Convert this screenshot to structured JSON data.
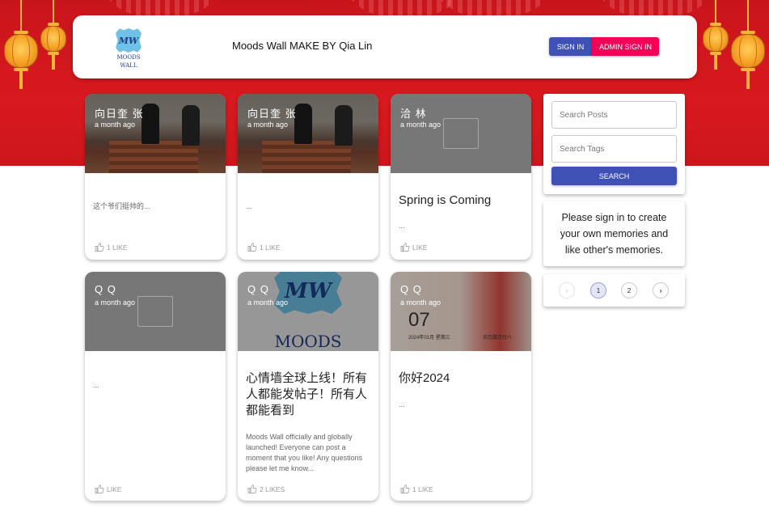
{
  "header": {
    "logo_initials": "MW",
    "logo_line1": "MOODS",
    "logo_line2": "WALL",
    "title": "Moods Wall MAKE BY Qia Lin",
    "signin_label": "SIGN IN",
    "admin_signin_label": "ADMIN SIGN IN"
  },
  "posts": [
    {
      "author": "向日奎 张",
      "time": "a month ago",
      "title": "",
      "message": "这个爷们挺帅的...",
      "likes": "1 LIKE",
      "image": "photo"
    },
    {
      "author": "向日奎 张",
      "time": "a month ago",
      "title": "",
      "message": "...",
      "likes": "1 LIKE",
      "image": "photo"
    },
    {
      "author": "洽 林",
      "time": "a month ago",
      "title": "Spring is Coming",
      "message": "...",
      "likes": "LIKE",
      "image": "placeholder"
    },
    {
      "author": "Q Q",
      "time": "a month ago",
      "title": "",
      "message": "...",
      "likes": "LIKE",
      "image": "placeholder"
    },
    {
      "author": "Q Q",
      "time": "a month ago",
      "title": "心情墙全球上线！所有人都能发帖子！所有人都能看到",
      "message": "Moods Wall officially and globally launched! Everyone can post a moment that you like! Any questions please let me know...",
      "likes": "2 LIKES",
      "image": "logo",
      "image_text_initials": "MW",
      "image_text_word": "MOODS"
    },
    {
      "author": "Q Q",
      "time": "a month ago",
      "title": "你好2024",
      "message": "...",
      "likes": "1 LIKE",
      "image": "calendar",
      "calendar_day": "07",
      "calendar_date": "2024年01月 星期三",
      "calendar_lunar": "农历腊月廿八"
    }
  ],
  "search": {
    "posts_placeholder": "Search Posts",
    "tags_placeholder": "Search Tags",
    "button_label": "SEARCH"
  },
  "signin_message": "Please sign in to create your own memories and like other's memories.",
  "pagination": {
    "prev": "‹",
    "pages": [
      "1",
      "2"
    ],
    "current": "1",
    "next": "›"
  },
  "colors": {
    "banner_red": "#d8191f",
    "primary": "#3f51b5",
    "secondary": "#f50057"
  }
}
